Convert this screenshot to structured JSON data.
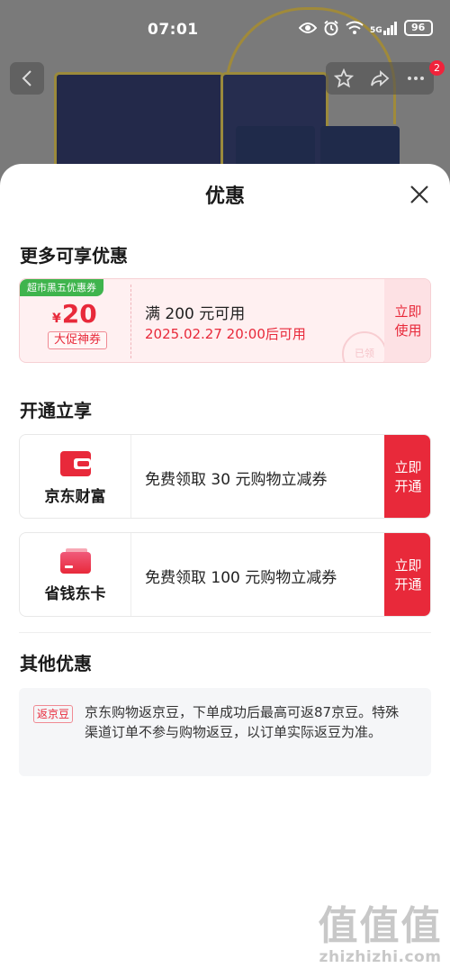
{
  "status": {
    "time": "07:01",
    "battery": "96",
    "network": "5G"
  },
  "nav": {
    "badge": "2"
  },
  "sheet": {
    "title": "优惠",
    "sections": {
      "more": "更多可享优惠",
      "open": "开通立享",
      "other": "其他优惠"
    }
  },
  "coupon": {
    "tag": "超市黑五优惠券",
    "currency": "¥",
    "value": "20",
    "label": "大促神券",
    "condition": "满 200 元可用",
    "time": "2025.02.27 20:00后可用",
    "action": "立即使用",
    "stamp": "已领"
  },
  "services": [
    {
      "name": "京东财富",
      "desc": "免费领取 30 元购物立减券",
      "action": "立即开通",
      "icon": "wallet-icon",
      "color": "#e8293a"
    },
    {
      "name": "省钱东卡",
      "desc": "免费领取 100 元购物立减券",
      "action": "立即开通",
      "icon": "card-icon",
      "color": "#e8293a"
    }
  ],
  "other": {
    "tag": "返京豆",
    "text": "京东购物返京豆，下单成功后最高可返87京豆。特殊渠道订单不参与购物返豆，以订单实际返豆为准。"
  },
  "watermark": {
    "logo": "值值值",
    "text": "zhizhizhi.com"
  },
  "colors": {
    "accent": "#e8293a",
    "coupon_bg": "#fff0f1",
    "tag_green": "#3fb44d"
  }
}
